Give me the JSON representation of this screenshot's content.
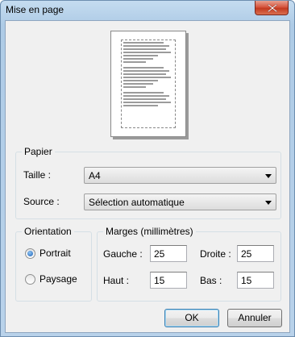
{
  "window": {
    "title": "Mise en page"
  },
  "colors": {
    "accent": "#3c7fb1",
    "close_button": "#c33a20",
    "window_frame": "#aecbe6",
    "client_bg": "#f0f0f0"
  },
  "icons": {
    "close": "close-icon",
    "combo_arrow": "chevron-down-icon"
  },
  "papier": {
    "title": "Papier",
    "taille_label": "Taille :",
    "taille_value": "A4",
    "source_label": "Source :",
    "source_value": "Sélection automatique"
  },
  "orientation": {
    "title": "Orientation",
    "portrait": "Portrait",
    "paysage": "Paysage",
    "selected": "Portrait"
  },
  "marges": {
    "title": "Marges (millimètres)",
    "gauche_label": "Gauche :",
    "gauche_value": "25",
    "droite_label": "Droite :",
    "droite_value": "25",
    "haut_label": "Haut :",
    "haut_value": "15",
    "bas_label": "Bas :",
    "bas_value": "15"
  },
  "buttons": {
    "ok": "OK",
    "annuler": "Annuler"
  }
}
